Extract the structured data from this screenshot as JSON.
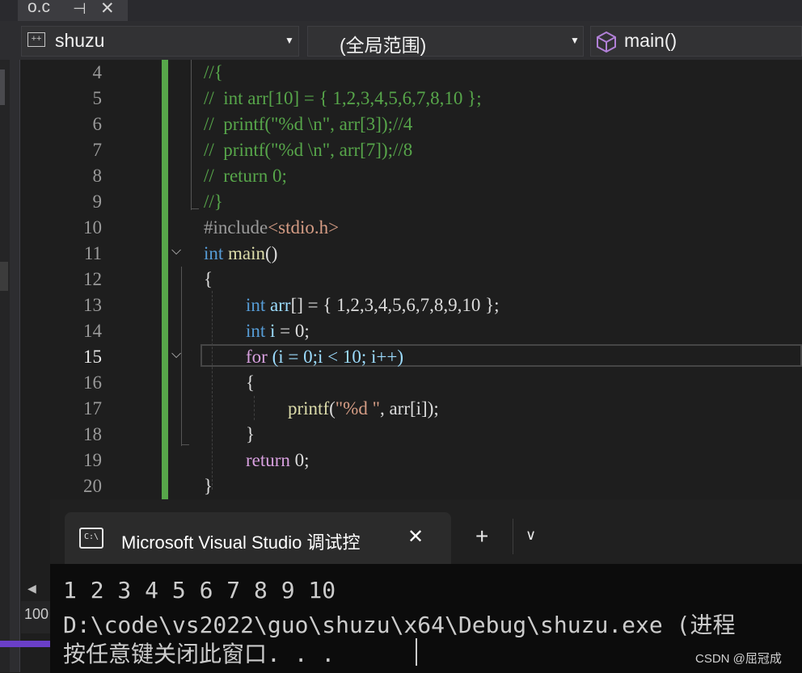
{
  "tab": {
    "title": "o.c",
    "pin_icon": "pin-icon",
    "close_icon": "close-icon"
  },
  "nav": {
    "file": "shuzu",
    "scope": "(全局范围)",
    "function": "main()"
  },
  "editor": {
    "current_line": 15,
    "line_numbers": [
      "4",
      "5",
      "6",
      "7",
      "8",
      "9",
      "10",
      "11",
      "12",
      "13",
      "14",
      "15",
      "16",
      "17",
      "18",
      "19",
      "20"
    ]
  },
  "code": {
    "l4": "//{",
    "l5": "//  int arr[10] = { 1,2,3,4,5,6,7,8,10 };",
    "l6": "//  printf(\"%d \\n\", arr[3]);//4",
    "l7": "//  printf(\"%d \\n\", arr[7]);//8",
    "l8": "//  return 0;",
    "l9": "//}",
    "l10_pp": "#include",
    "l10_hdr": "<stdio.h>",
    "l11_kw": "int",
    "l11_fn": "main",
    "l11_rest": "()",
    "l12": "{",
    "l13_kw": "int",
    "l13_var": "arr",
    "l13_rest": "[] = { 1,2,3,4,5,6,7,8,9,10 };",
    "l14_kw": "int",
    "l14_var": "i",
    "l14_rest": " = 0;",
    "l15_kw": "for",
    "l15_rest": " (i = 0;i < 10; i++)",
    "l16": "{",
    "l17_fn": "printf",
    "l17_open": "(",
    "l17_str": "\"%d \"",
    "l17_rest": ", arr[i]);",
    "l18": "}",
    "l19_kw": "return",
    "l19_rest": " 0;",
    "l20": "}"
  },
  "console": {
    "title": "Microsoft Visual Studio 调试控",
    "output": [
      "1 2 3 4 5 6 7 8 9 10",
      "D:\\code\\vs2022\\guo\\shuzu\\x64\\Debug\\shuzu.exe (进程",
      "按任意键关闭此窗口. . ."
    ],
    "icon_label": "C:\\"
  },
  "zoom": "100",
  "watermark": "CSDN @屈冠成",
  "colors": {
    "comment": "#57a64a",
    "keyword": "#569cd6",
    "control": "#d8a0df",
    "variable": "#9cdcfe",
    "function": "#dcdcaa",
    "string": "#d69d85",
    "change_bar": "#57a64a"
  }
}
